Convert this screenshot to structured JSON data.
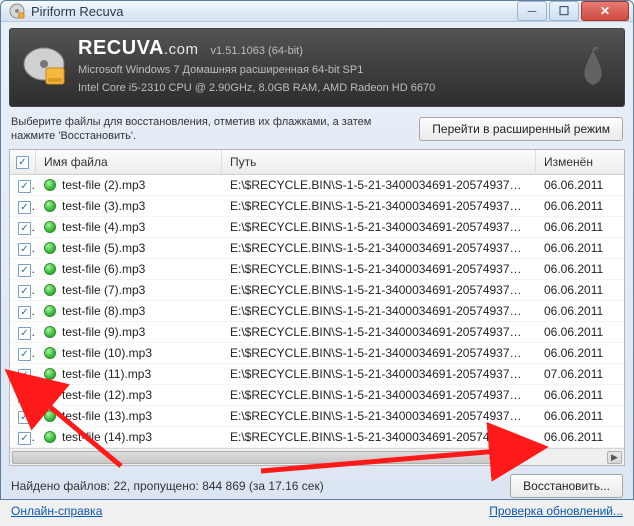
{
  "title": "Piriform Recuva",
  "brand": {
    "name": "RECUVA",
    "domain": ".com",
    "version": "v1.51.1063 (64-bit)",
    "sys1": "Microsoft Windows 7 Домашняя расширенная 64-bit SP1",
    "sys2": "Intel Core i5-2310 CPU @ 2.90GHz, 8.0GB RAM, AMD Radeon HD 6670"
  },
  "instruction": "Выберите файлы для восстановления, отметив их флажками, а затем нажмите 'Восстановить'.",
  "advanced_btn": "Перейти в расширенный режим",
  "columns": {
    "name": "Имя файла",
    "path": "Путь",
    "date": "Изменён"
  },
  "rows": [
    {
      "name": "test-file (2).mp3",
      "path": "E:\\$RECYCLE.BIN\\S-1-5-21-3400034691-2057493740-...",
      "date": "06.06.2011"
    },
    {
      "name": "test-file (3).mp3",
      "path": "E:\\$RECYCLE.BIN\\S-1-5-21-3400034691-2057493740-...",
      "date": "06.06.2011"
    },
    {
      "name": "test-file (4).mp3",
      "path": "E:\\$RECYCLE.BIN\\S-1-5-21-3400034691-2057493740-...",
      "date": "06.06.2011"
    },
    {
      "name": "test-file (5).mp3",
      "path": "E:\\$RECYCLE.BIN\\S-1-5-21-3400034691-2057493740-...",
      "date": "06.06.2011"
    },
    {
      "name": "test-file (6).mp3",
      "path": "E:\\$RECYCLE.BIN\\S-1-5-21-3400034691-2057493740-...",
      "date": "06.06.2011"
    },
    {
      "name": "test-file (7).mp3",
      "path": "E:\\$RECYCLE.BIN\\S-1-5-21-3400034691-2057493740-...",
      "date": "06.06.2011"
    },
    {
      "name": "test-file (8).mp3",
      "path": "E:\\$RECYCLE.BIN\\S-1-5-21-3400034691-2057493740-...",
      "date": "06.06.2011"
    },
    {
      "name": "test-file (9).mp3",
      "path": "E:\\$RECYCLE.BIN\\S-1-5-21-3400034691-2057493740-...",
      "date": "06.06.2011"
    },
    {
      "name": "test-file (10).mp3",
      "path": "E:\\$RECYCLE.BIN\\S-1-5-21-3400034691-2057493740-...",
      "date": "06.06.2011"
    },
    {
      "name": "test-file (11).mp3",
      "path": "E:\\$RECYCLE.BIN\\S-1-5-21-3400034691-2057493740-...",
      "date": "07.06.2011"
    },
    {
      "name": "test-file (12).mp3",
      "path": "E:\\$RECYCLE.BIN\\S-1-5-21-3400034691-2057493740-...",
      "date": "06.06.2011"
    },
    {
      "name": "test-file (13).mp3",
      "path": "E:\\$RECYCLE.BIN\\S-1-5-21-3400034691-2057493740-...",
      "date": "06.06.2011"
    },
    {
      "name": "test-file (14).mp3",
      "path": "E:\\$RECYCLE.BIN\\S-1-5-21-3400034691-2057493740-...",
      "date": "06.06.2011"
    }
  ],
  "status": "Найдено файлов: 22, пропущено: 844 869 (за 17.16 сек)",
  "recover_btn": "Восстановить...",
  "links": {
    "help": "Онлайн-справка",
    "updates": "Проверка обновлений..."
  }
}
